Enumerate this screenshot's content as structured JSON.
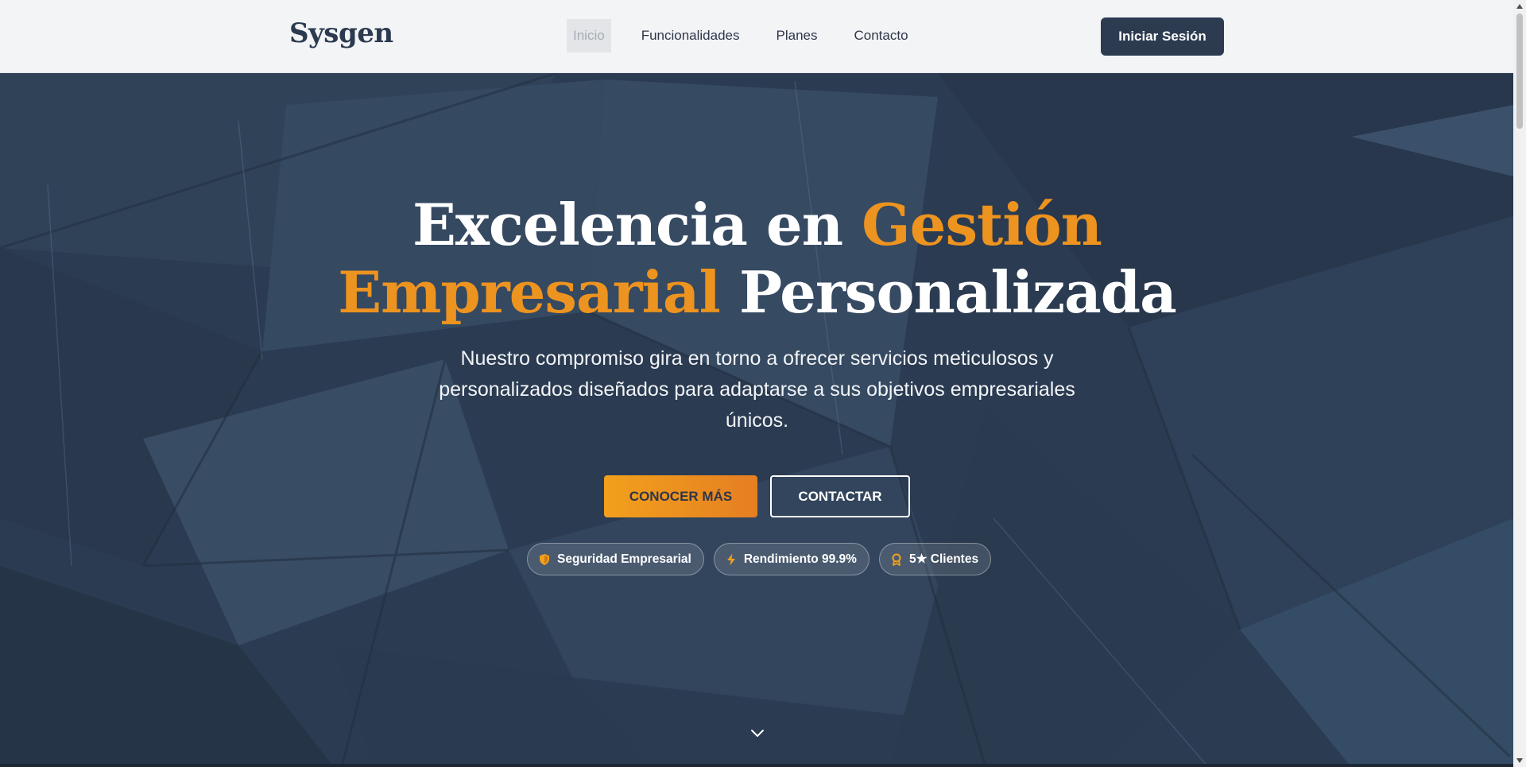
{
  "brand": {
    "name": "Sysgen"
  },
  "nav": {
    "items": [
      {
        "label": "Inicio",
        "active": true
      },
      {
        "label": "Funcionalidades",
        "active": false
      },
      {
        "label": "Planes",
        "active": false
      },
      {
        "label": "Contacto",
        "active": false
      }
    ],
    "login_label": "Iniciar Sesión"
  },
  "hero": {
    "headline": {
      "part1": "Excelencia en ",
      "accent1": "Gestión",
      "accent2": "Empresarial",
      "part2": " Personalizada"
    },
    "subtitle": "Nuestro compromiso gira en torno a ofrecer servicios meticulosos y personalizados diseñados para adaptarse a sus objetivos empresariales únicos.",
    "primary_cta": "CONOCER MÁS",
    "secondary_cta": "CONTACTAR",
    "badges": [
      {
        "icon": "shield-icon",
        "label": "Seguridad Empresarial"
      },
      {
        "icon": "lightning-icon",
        "label": "Rendimiento 99.9%"
      },
      {
        "icon": "award-icon",
        "label": "5★ Clientes"
      }
    ],
    "scroll_icon": "chevron-down-icon"
  },
  "colors": {
    "accent": "#ed931f",
    "navy": "#2d3b51",
    "hero_bg": "#2e3f56",
    "nav_bg": "#f3f4f6"
  }
}
